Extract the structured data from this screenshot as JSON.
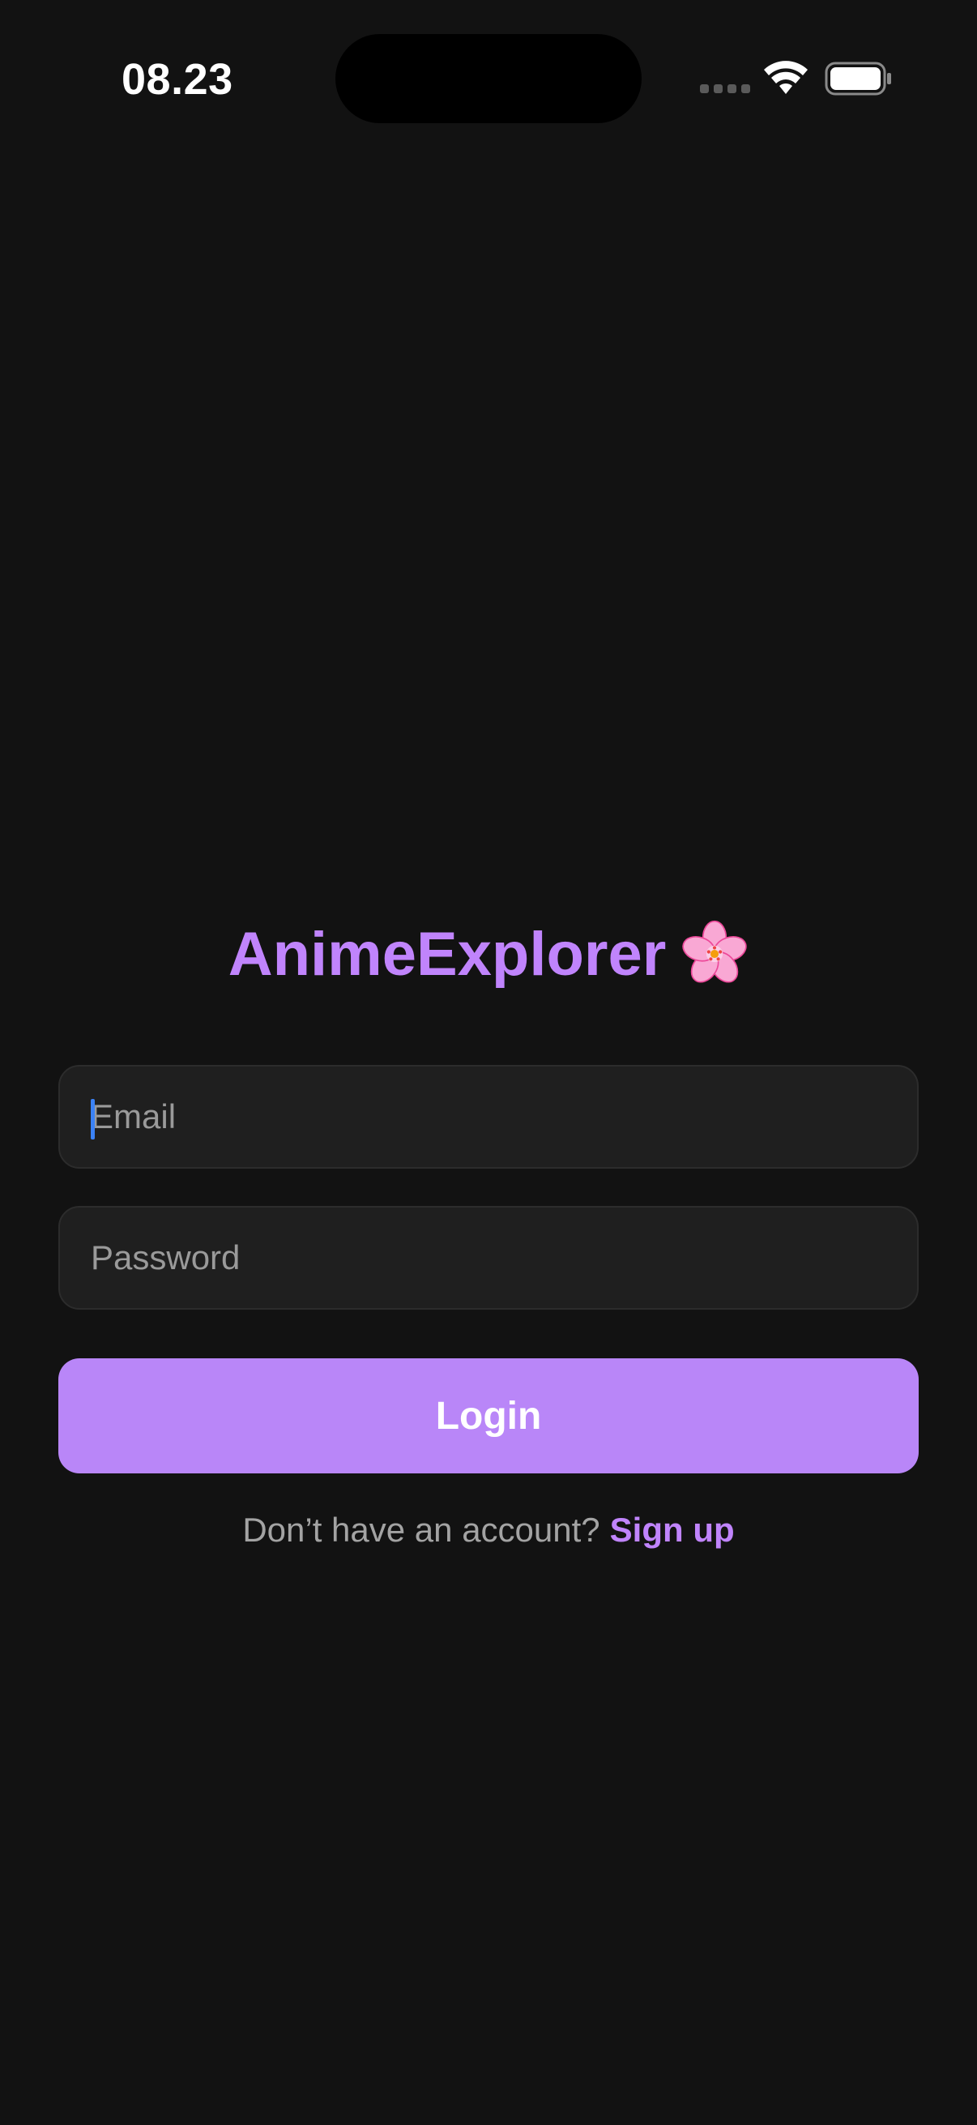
{
  "status_bar": {
    "time": "08.23",
    "icons": [
      "signal-dots-icon",
      "wifi-icon",
      "battery-icon"
    ]
  },
  "app": {
    "title": "AnimeExplorer",
    "title_icon": "cherry-blossom-icon"
  },
  "form": {
    "email_placeholder": "Email",
    "email_value": "",
    "password_placeholder": "Password",
    "password_value": "",
    "login_label": "Login"
  },
  "signup": {
    "prompt": "Don’t have an account?",
    "link_label": "Sign up"
  },
  "colors": {
    "background": "#121212",
    "accent": "#c084fc",
    "button": "#b986f8",
    "input_background": "#1f1f1f",
    "caret": "#3b82f6"
  }
}
